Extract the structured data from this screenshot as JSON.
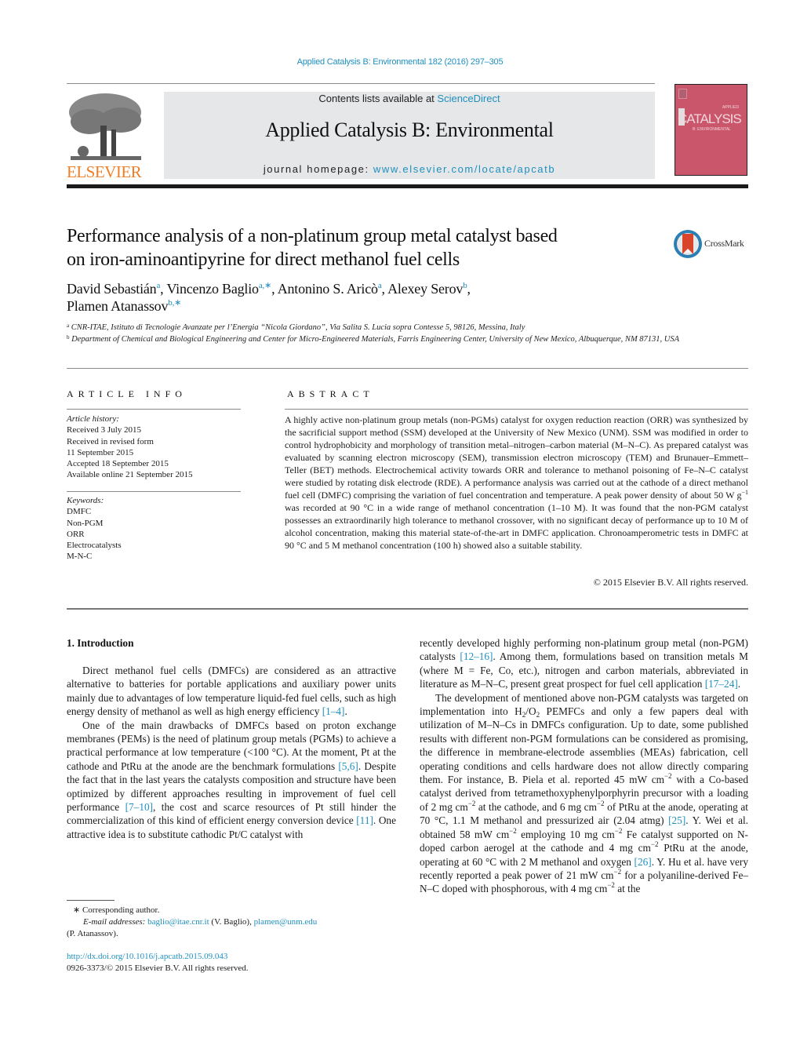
{
  "header": {
    "citation": "Applied Catalysis B: Environmental 182 (2016) 297–305",
    "contents_prefix": "Contents lists available at ",
    "contents_link": "ScienceDirect",
    "journal_title": "Applied Catalysis B: Environmental",
    "homepage_prefix": "journal homepage: ",
    "homepage_link": "www.elsevier.com/locate/apcatb",
    "publisher_logo_text": "ELSEVIER",
    "cover_title": "CATALYSIS",
    "cover_top": "APPLIED",
    "cover_sub": "B: ENVIRONMENTAL",
    "colors": {
      "link": "#1f8fbf",
      "elsevier_orange": "#f07e26",
      "cover": "#c9566b",
      "banner": "#e6e7e8"
    }
  },
  "article": {
    "title_line1": "Performance analysis of a non-platinum group metal catalyst based",
    "title_line2": "on iron-aminoantipyrine for direct methanol fuel cells",
    "crossmark_label": "CrossMark",
    "authors": [
      {
        "name": "David Sebastián",
        "sup": "a"
      },
      {
        "name": "Vincenzo Baglio",
        "sup": "a,∗"
      },
      {
        "name": "Antonino S. Aricò",
        "sup": "a"
      },
      {
        "name": "Alexey Serov",
        "sup": "b"
      },
      {
        "name": "Plamen Atanassov",
        "sup": "b,∗"
      }
    ],
    "affiliations": [
      {
        "mark": "a",
        "text": "CNR-ITAE, Istituto di Tecnologie Avanzate per l’Energia “Nicola Giordano”, Via Salita S. Lucia sopra Contesse 5, 98126, Messina, Italy"
      },
      {
        "mark": "b",
        "text": "Department of Chemical and Biological Engineering and Center for Micro-Engineered Materials, Farris Engineering Center, University of New Mexico, Albuquerque, NM 87131, USA"
      }
    ]
  },
  "article_info": {
    "heading": "ARTICLE INFO",
    "history_label": "Article history:",
    "history": [
      "Received 3 July 2015",
      "Received in revised form",
      "11 September 2015",
      "Accepted 18 September 2015",
      "Available online 21 September 2015"
    ],
    "keywords_label": "Keywords:",
    "keywords": [
      "DMFC",
      "Non-PGM",
      "ORR",
      "Electrocatalysts",
      "M-N-C"
    ]
  },
  "abstract": {
    "heading": "ABSTRACT",
    "text_part1": "A highly active non-platinum group metals (non-PGMs) catalyst for oxygen reduction reaction (ORR) was synthesized by the sacrificial support method (SSM) developed at the University of New Mexico (UNM). SSM was modified in order to control hydrophobicity and morphology of transition metal–nitrogen–carbon material (M–N–C). As prepared catalyst was evaluated by scanning electron microscopy (SEM), transmission electron microscopy (TEM) and Brunauer–Emmett–Teller (BET) methods. Electrochemical activity towards ORR and tolerance to methanol poisoning of Fe–N–C catalyst were studied by rotating disk electrode (RDE). A performance analysis was carried out at the cathode of a direct methanol fuel cell (DMFC) comprising the variation of fuel concentration and temperature. A peak power density of about 50 W g",
    "text_sup": "−1",
    "text_part2": " was recorded at 90 °C in a wide range of methanol concentration (1–10 M). It was found that the non-PGM catalyst possesses an extraordinarily high tolerance to methanol crossover, with no significant decay of performance up to 10 M of alcohol concentration, making this material state-of-the-art in DMFC application. Chronoamperometric tests in DMFC at 90 °C and 5 M methanol concentration (100 h) showed also a suitable stability.",
    "copyright": "© 2015 Elsevier B.V. All rights reserved."
  },
  "body": {
    "section_heading": "1.  Introduction",
    "left": {
      "p1_text": "Direct methanol fuel cells (DMFCs) are considered as an attractive alternative to batteries for portable applications and auxiliary power units mainly due to advantages of low temperature liquid-fed fuel cells, such as high energy density of methanol as well as high energy efficiency ",
      "p1_ref": "[1–4]",
      "p2_a": "One of the main drawbacks of DMFCs based on proton exchange membranes (PEMs) is the need of platinum group metals (PGMs) to achieve a practical performance at low temperature (<100 °C). At the moment, Pt at the cathode and PtRu at the anode are the benchmark formulations ",
      "p2_ref1": "[5,6]",
      "p2_b": ". Despite the fact that in the last years the catalysts composition and structure have been optimized by different approaches resulting in improvement of fuel cell performance ",
      "p2_ref2": "[7–10]",
      "p2_c": ", the cost and scarce resources of Pt still hinder the commercialization of this kind of efficient energy conversion device ",
      "p2_ref3": "[11]",
      "p2_d": ". One attractive idea is to substitute cathodic Pt/C catalyst with"
    },
    "right": {
      "p1_a": "recently developed highly performing non-platinum group metal (non-PGM) catalysts ",
      "p1_ref1": "[12–16]",
      "p1_b": ". Among them, formulations based on transition metals M (where M = Fe, Co, etc.), nitrogen and carbon materials, abbreviated in literature as M–N–C, present great prospect for fuel cell application ",
      "p1_ref2": "[17–24]",
      "p2_a": "The development of mentioned above non-PGM catalysts was targeted on implementation into H",
      "p2_sub1": "2",
      "p2_slash": "/O",
      "p2_sub2": "2",
      "p2_b": " PEMFCs and only a few papers deal with utilization of M–N–Cs in DMFCs configuration. Up to date, some published results with different non-PGM formulations can be considered as promising, the difference in membrane-electrode assemblies (MEAs) fabrication, cell operating conditions and cells hardware does not allow directly comparing them. For instance, B. Piela et al. reported 45 mW cm",
      "sup": "−2",
      "p2_c": " with a Co-based catalyst derived from tetramethoxyphenylporphyrin precursor with a loading of 2 mg cm",
      "p2_d": " at the cathode, and 6 mg cm",
      "p2_e": " of PtRu at the anode, operating at 70 °C, 1.1 M methanol and pressurized air (2.04 atmg) ",
      "p2_ref1": "[25]",
      "p2_f": ". Y. Wei et al. obtained 58 mW cm",
      "p2_g": " employing 10 mg cm",
      "p2_h": " Fe catalyst supported on N-doped carbon aerogel at the cathode and 4 mg cm",
      "p2_i": " PtRu at the anode, operating at 60 °C with 2 M methanol and oxygen ",
      "p2_ref2": "[26]",
      "p2_j": ". Y. Hu et al. have very recently reported a peak power of 21 mW cm",
      "p2_k": " for a polyaniline-derived Fe–N–C doped with phosphorous, with 4 mg cm",
      "p2_l": " at the"
    }
  },
  "footer": {
    "corresponding": "∗  Corresponding author.",
    "email_label": "E-mail addresses:",
    "email1": "baglio@itae.cnr.it",
    "email1_owner": " (V. Baglio), ",
    "email2": "plamen@unm.edu",
    "email2_owner": "(P. Atanassov).",
    "doi": "http://dx.doi.org/10.1016/j.apcatb.2015.09.043",
    "issn_rights": "0926-3373/© 2015 Elsevier B.V. All rights reserved."
  }
}
